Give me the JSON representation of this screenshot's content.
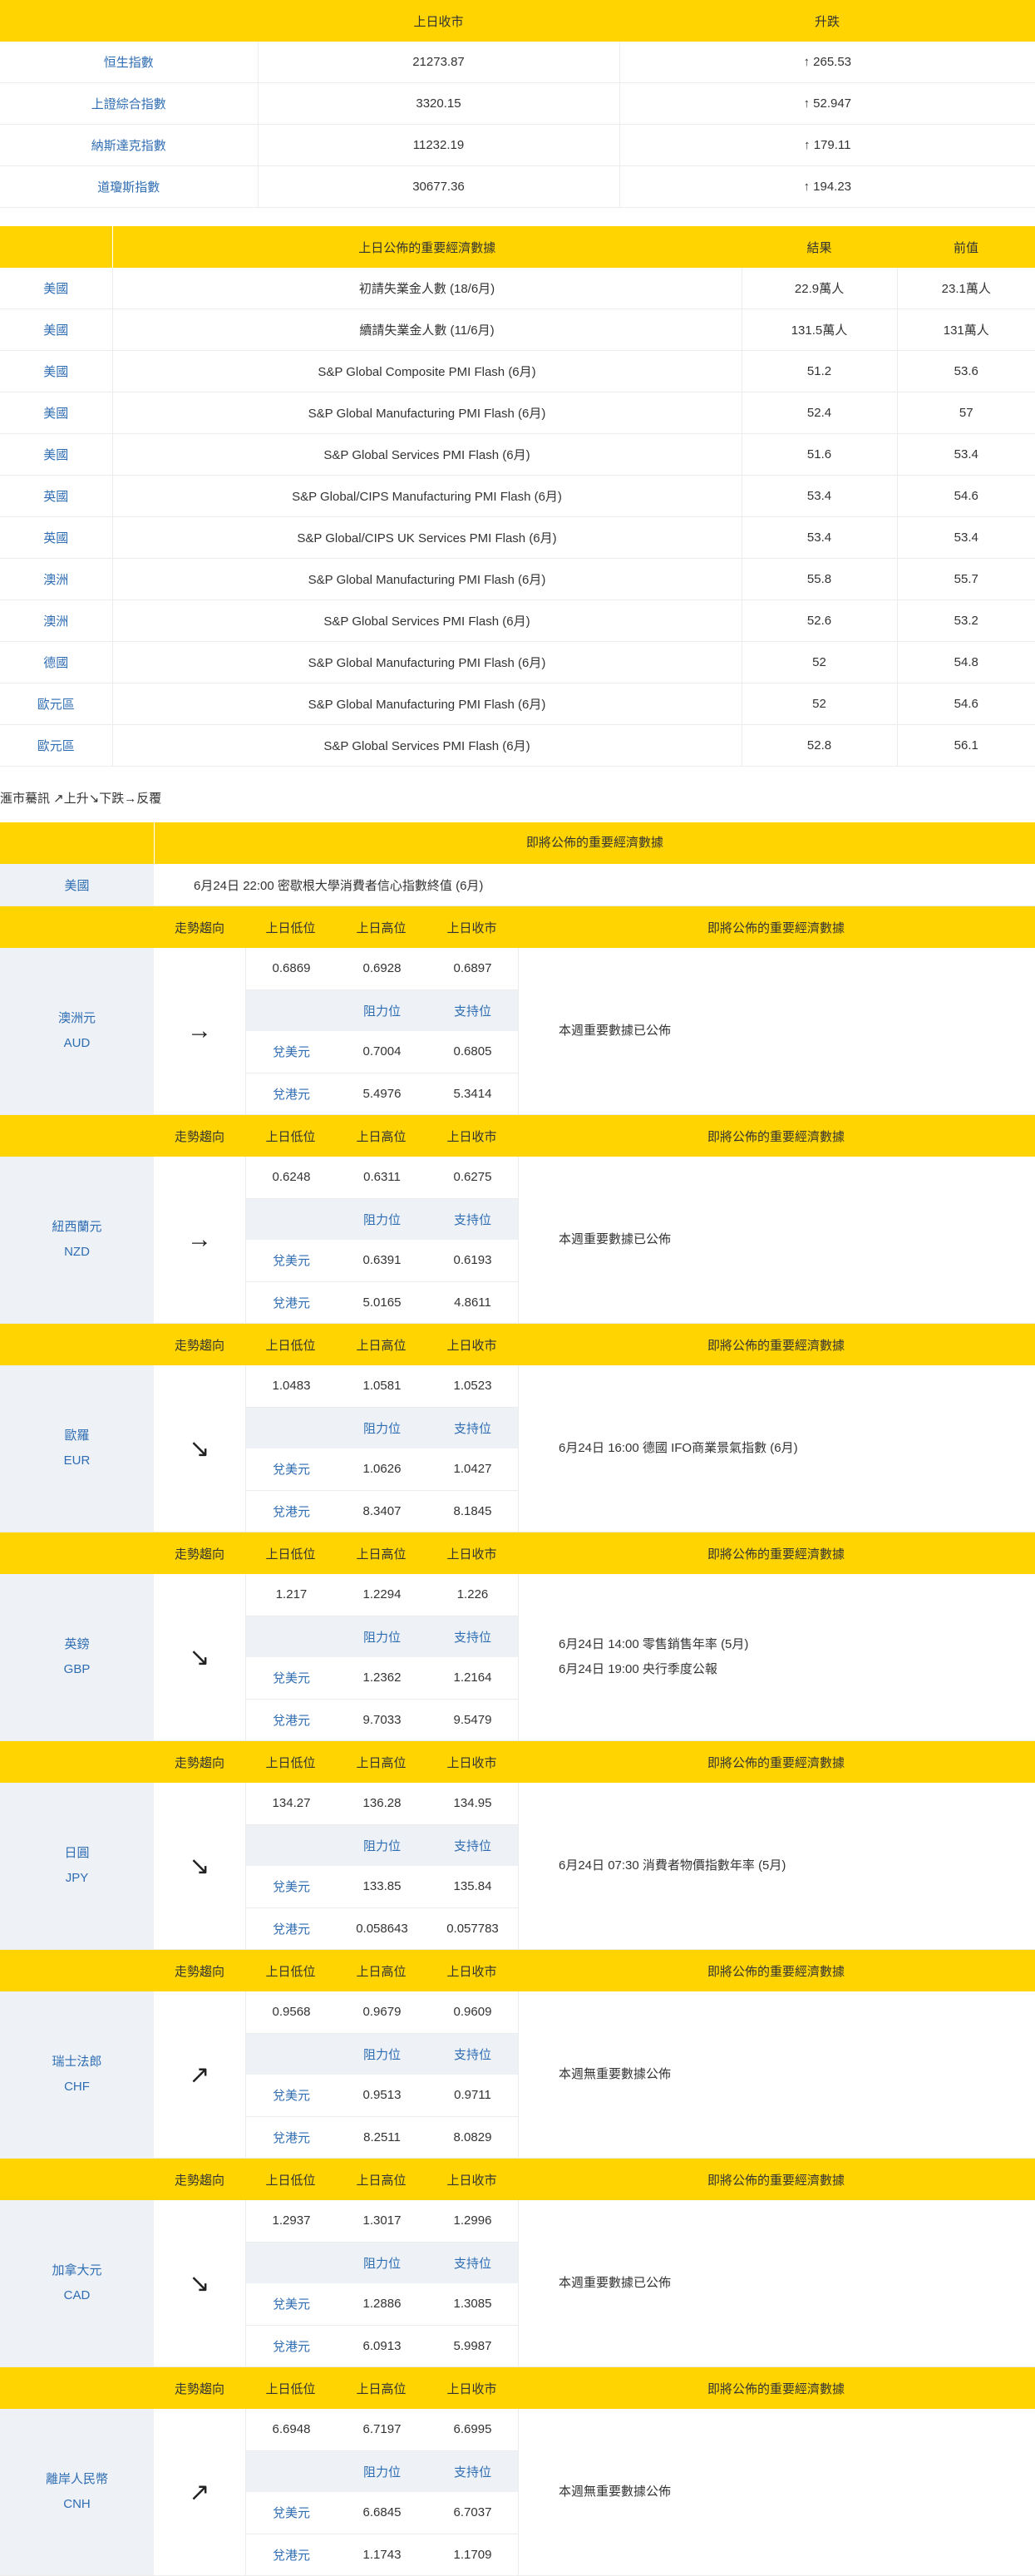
{
  "indices": {
    "headers": [
      "",
      "上日收市",
      "升跌"
    ],
    "rows": [
      {
        "name": "恒生指數",
        "close": "21273.87",
        "change": "↑  265.53"
      },
      {
        "name": "上證綜合指數",
        "close": "3320.15",
        "change": "↑  52.947"
      },
      {
        "name": "納斯達克指數",
        "close": "11232.19",
        "change": "↑  179.11"
      },
      {
        "name": "道瓊斯指數",
        "close": "30677.36",
        "change": "↑  194.23"
      }
    ]
  },
  "econ": {
    "headers": [
      "",
      "上日公佈的重要經濟數據",
      "結果",
      "前值"
    ],
    "rows": [
      {
        "region": "美國",
        "item": "初請失業金人數 (18/6月)",
        "result": "22.9萬人",
        "prev": "23.1萬人"
      },
      {
        "region": "美國",
        "item": "續請失業金人數 (11/6月)",
        "result": "131.5萬人",
        "prev": "131萬人"
      },
      {
        "region": "美國",
        "item": "S&P Global Composite PMI Flash (6月)",
        "result": "51.2",
        "prev": "53.6"
      },
      {
        "region": "美國",
        "item": "S&P Global Manufacturing PMI Flash (6月)",
        "result": "52.4",
        "prev": "57"
      },
      {
        "region": "美國",
        "item": "S&P Global Services PMI Flash (6月)",
        "result": "51.6",
        "prev": "53.4"
      },
      {
        "region": "英國",
        "item": "S&P Global/CIPS Manufacturing PMI Flash (6月)",
        "result": "53.4",
        "prev": "54.6"
      },
      {
        "region": "英國",
        "item": "S&P Global/CIPS UK Services PMI Flash (6月)",
        "result": "53.4",
        "prev": "53.4"
      },
      {
        "region": "澳洲",
        "item": "S&P Global Manufacturing PMI Flash (6月)",
        "result": "55.8",
        "prev": "55.7"
      },
      {
        "region": "澳洲",
        "item": "S&P Global Services PMI Flash (6月)",
        "result": "52.6",
        "prev": "53.2"
      },
      {
        "region": "德國",
        "item": "S&P Global Manufacturing PMI Flash (6月)",
        "result": "52",
        "prev": "54.8"
      },
      {
        "region": "歐元區",
        "item": "S&P Global Manufacturing PMI Flash (6月)",
        "result": "52",
        "prev": "54.6"
      },
      {
        "region": "歐元區",
        "item": "S&P Global Services PMI Flash (6月)",
        "result": "52.8",
        "prev": "56.1"
      }
    ]
  },
  "legend": "滙市驀訊 ↗上升↘下跌→反覆",
  "fx": {
    "title": "即將公佈的重要經濟數據",
    "us": {
      "region": "美國",
      "event": "6月24日 22:00  密歇根大學消費者信心指數終值 (6月)"
    },
    "col_headers": {
      "trend": "走勢趨向",
      "low": "上日低位",
      "high": "上日高位",
      "close": "上日收市",
      "events": "即將公佈的重要經濟數據"
    },
    "sub_headers": {
      "resistance": "阻力位",
      "support": "支持位",
      "vs_usd": "兌美元",
      "vs_hkd": "兌港元"
    },
    "currencies": [
      {
        "name_zh": "澳洲元",
        "code": "AUD",
        "trend": "→",
        "low": "0.6869",
        "high": "0.6928",
        "close": "0.6897",
        "usd_res": "0.7004",
        "usd_sup": "0.6805",
        "hkd_res": "5.4976",
        "hkd_sup": "5.3414",
        "events": [
          "本週重要數據已公佈"
        ]
      },
      {
        "name_zh": "紐西蘭元",
        "code": "NZD",
        "trend": "→",
        "low": "0.6248",
        "high": "0.6311",
        "close": "0.6275",
        "usd_res": "0.6391",
        "usd_sup": "0.6193",
        "hkd_res": "5.0165",
        "hkd_sup": "4.8611",
        "events": [
          "本週重要數據已公佈"
        ]
      },
      {
        "name_zh": "歐羅",
        "code": "EUR",
        "trend": "↘",
        "low": "1.0483",
        "high": "1.0581",
        "close": "1.0523",
        "usd_res": "1.0626",
        "usd_sup": "1.0427",
        "hkd_res": "8.3407",
        "hkd_sup": "8.1845",
        "events": [
          "6月24日 16:00  德國 IFO商業景氣指數 (6月)"
        ]
      },
      {
        "name_zh": "英鎊",
        "code": "GBP",
        "trend": "↘",
        "low": "1.217",
        "high": "1.2294",
        "close": "1.226",
        "usd_res": "1.2362",
        "usd_sup": "1.2164",
        "hkd_res": "9.7033",
        "hkd_sup": "9.5479",
        "events": [
          "6月24日 14:00  零售銷售年率 (5月)",
          "6月24日 19:00  央行季度公報"
        ]
      },
      {
        "name_zh": "日圓",
        "code": "JPY",
        "trend": "↘",
        "low": "134.27",
        "high": "136.28",
        "close": "134.95",
        "usd_res": "133.85",
        "usd_sup": "135.84",
        "hkd_res": "0.058643",
        "hkd_sup": "0.057783",
        "events": [
          "6月24日 07:30  消費者物價指數年率 (5月)"
        ]
      },
      {
        "name_zh": "瑞士法郎",
        "code": "CHF",
        "trend": "↗",
        "low": "0.9568",
        "high": "0.9679",
        "close": "0.9609",
        "usd_res": "0.9513",
        "usd_sup": "0.9711",
        "hkd_res": "8.2511",
        "hkd_sup": "8.0829",
        "events": [
          "本週無重要數據公佈"
        ]
      },
      {
        "name_zh": "加拿大元",
        "code": "CAD",
        "trend": "↘",
        "low": "1.2937",
        "high": "1.3017",
        "close": "1.2996",
        "usd_res": "1.2886",
        "usd_sup": "1.3085",
        "hkd_res": "6.0913",
        "hkd_sup": "5.9987",
        "events": [
          "本週重要數據已公佈"
        ]
      },
      {
        "name_zh": "離岸人民幣",
        "code": "CNH",
        "trend": "↗",
        "low": "6.6948",
        "high": "6.7197",
        "close": "6.6995",
        "usd_res": "6.6845",
        "usd_sup": "6.7037",
        "hkd_res": "1.1743",
        "hkd_sup": "1.1709",
        "events": [
          "本週無重要數據公佈"
        ]
      }
    ]
  }
}
